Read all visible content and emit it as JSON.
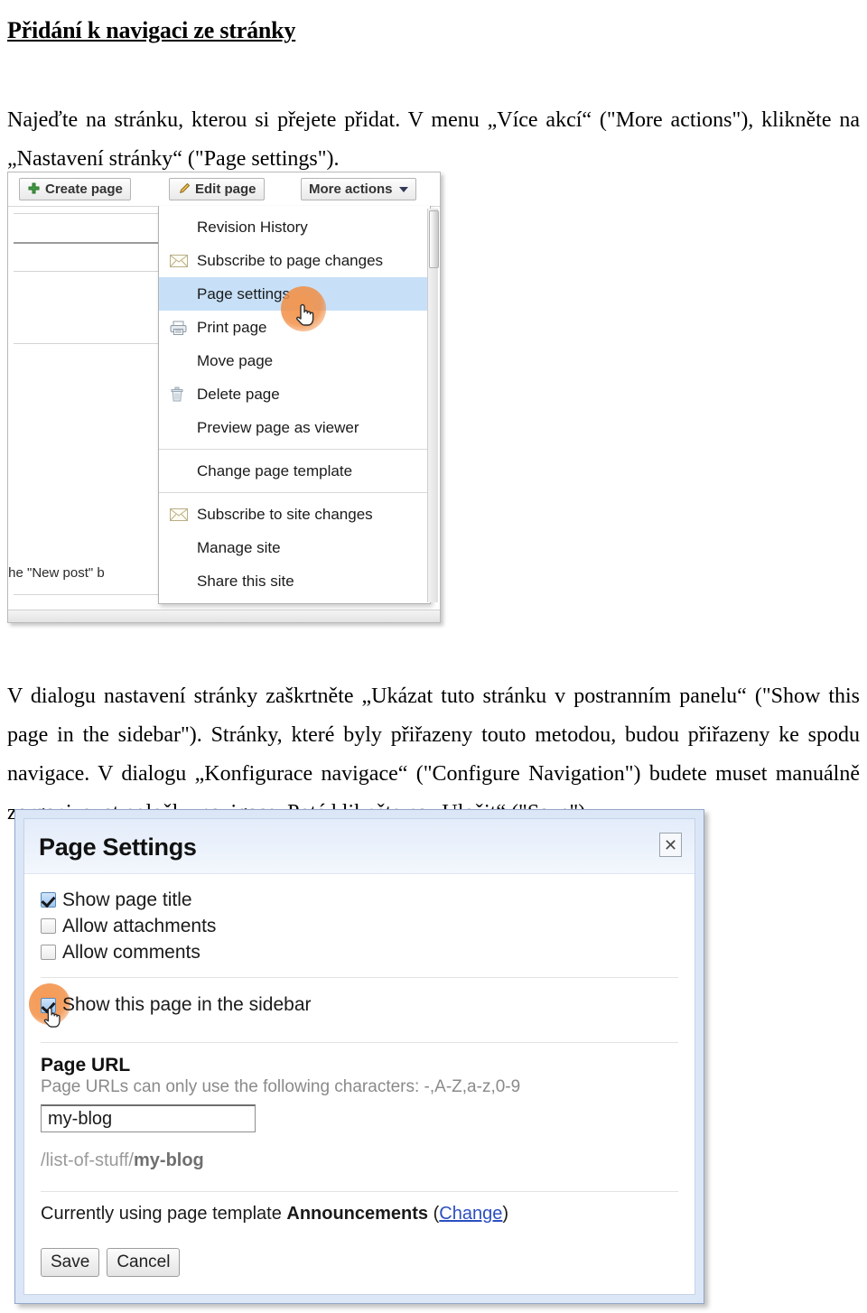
{
  "document": {
    "heading": "Přidání k navigaci ze stránky",
    "paragraph_1": "Najeďte na stránku, kterou si přejete přidat. V menu „Více akcí“ (\"More actions\"), klikněte na „Nastavení stránky“ (\"Page settings\").",
    "paragraph_2": "V dialogu nastavení stránky zaškrtněte „Ukázat tuto stránku v postranním panelu“ (\"Show this page in the sidebar\"). Stránky, které byly přiřazeny touto metodou, budou přiřazeny ke spodu navigace. V dialogu „Konfigurace navigace“ (\"Configure Navigation\") budete muset manuálně zorganizovat položky navigace. Poté klikněte na „Uložit“ (\"Save\")."
  },
  "screenshot_menu": {
    "toolbar": {
      "create_page": "Create page",
      "edit_page": "Edit page",
      "more_actions": "More actions"
    },
    "page_text_fragment": "the \"New post\" b",
    "menu_items": [
      {
        "label": "Revision History",
        "icon": "",
        "selected": false,
        "separator_after": false
      },
      {
        "label": "Subscribe to page changes",
        "icon": "envelope-icon",
        "selected": false,
        "separator_after": false
      },
      {
        "label": "Page settings",
        "icon": "",
        "selected": true,
        "separator_after": false
      },
      {
        "label": "Print page",
        "icon": "printer-icon",
        "selected": false,
        "separator_after": false
      },
      {
        "label": "Move page",
        "icon": "",
        "selected": false,
        "separator_after": false
      },
      {
        "label": "Delete page",
        "icon": "trash-icon",
        "selected": false,
        "separator_after": false
      },
      {
        "label": "Preview page as viewer",
        "icon": "",
        "selected": false,
        "separator_after": true
      },
      {
        "label": "Change page template",
        "icon": "",
        "selected": false,
        "separator_after": true
      },
      {
        "label": "Subscribe to site changes",
        "icon": "envelope-icon",
        "selected": false,
        "separator_after": false
      },
      {
        "label": "Manage site",
        "icon": "",
        "selected": false,
        "separator_after": false
      },
      {
        "label": "Share this site",
        "icon": "",
        "selected": false,
        "separator_after": false
      }
    ]
  },
  "screenshot_dialog": {
    "title": "Page Settings",
    "close_glyph": "✕",
    "checkboxes": [
      {
        "label": "Show page title",
        "checked": true
      },
      {
        "label": "Allow attachments",
        "checked": false
      },
      {
        "label": "Allow comments",
        "checked": false
      }
    ],
    "sidebar_checkbox": {
      "label": "Show this page in the sidebar",
      "checked": true
    },
    "page_url_label": "Page URL",
    "page_url_hint": "Page URLs can only use the following characters: -,A-Z,a-z,0-9",
    "page_url_value": "my-blog",
    "url_preview_prefix": "/list-of-stuff/",
    "url_preview_slug": "my-blog",
    "template_prefix": "Currently using page template ",
    "template_name": "Announcements",
    "template_change_open": " (",
    "template_change_label": "Change",
    "template_change_close": ")",
    "save_label": "Save",
    "cancel_label": "Cancel"
  },
  "colors": {
    "menu_selected": "#c7e0f7",
    "dialog_chrome": "#dbe6f7",
    "click_highlight": "#f08c46",
    "link": "#2b4fc0"
  }
}
